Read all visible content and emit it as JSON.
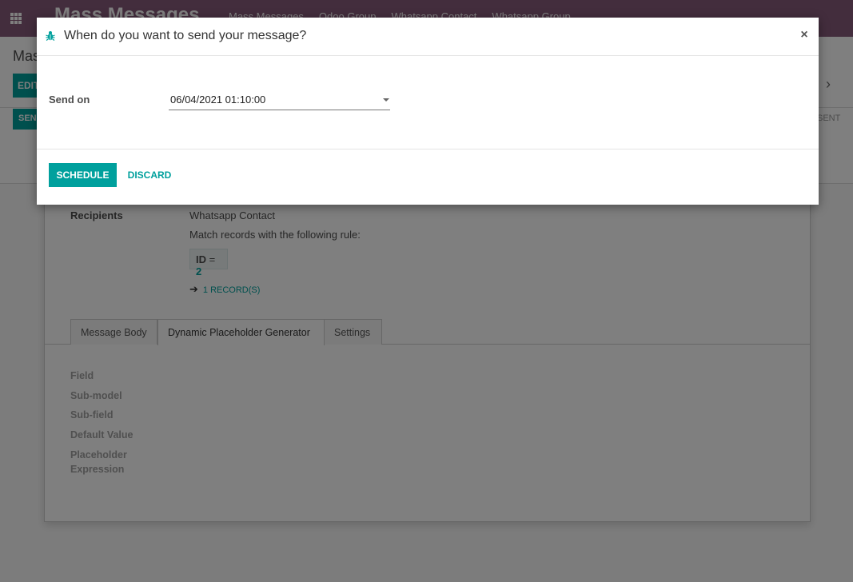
{
  "app": {
    "brand": "Mass Messages",
    "menu": [
      "Mass Messages",
      "Odoo Group",
      "Whatsapp Contact",
      "Whatsapp Group"
    ]
  },
  "control_panel": {
    "breadcrumb": "Mass Messages / Test",
    "edit_label": "EDIT",
    "send_label": "SEND",
    "status_sent": "SENT",
    "next_icon": "chevron-right-icon"
  },
  "sheet": {
    "recipients_label": "Recipients",
    "recipients_model": "Whatsapp Contact",
    "rule_text": "Match records with the following rule:",
    "domain_field": "ID",
    "domain_op": "=",
    "domain_value": "2",
    "records_link": "1 RECORD(S)",
    "tabs": [
      "Message Body",
      "Dynamic Placeholder Generator",
      "Settings"
    ],
    "active_tab": "Dynamic Placeholder Generator",
    "fields": [
      "Field",
      "Sub-model",
      "Sub-field",
      "Default Value",
      "Placeholder",
      "Expression"
    ]
  },
  "modal": {
    "title": "When do you want to send your message?",
    "title_icon": "bug-icon",
    "send_on_label": "Send on",
    "send_on_value": "06/04/2021 01:10:00",
    "schedule_label": "SCHEDULE",
    "discard_label": "DISCARD",
    "close_symbol": "×"
  },
  "colors": {
    "brand_purple": "#875a7b",
    "accent_teal": "#00a09d",
    "overlay": "rgba(0,0,0,0.5)"
  }
}
